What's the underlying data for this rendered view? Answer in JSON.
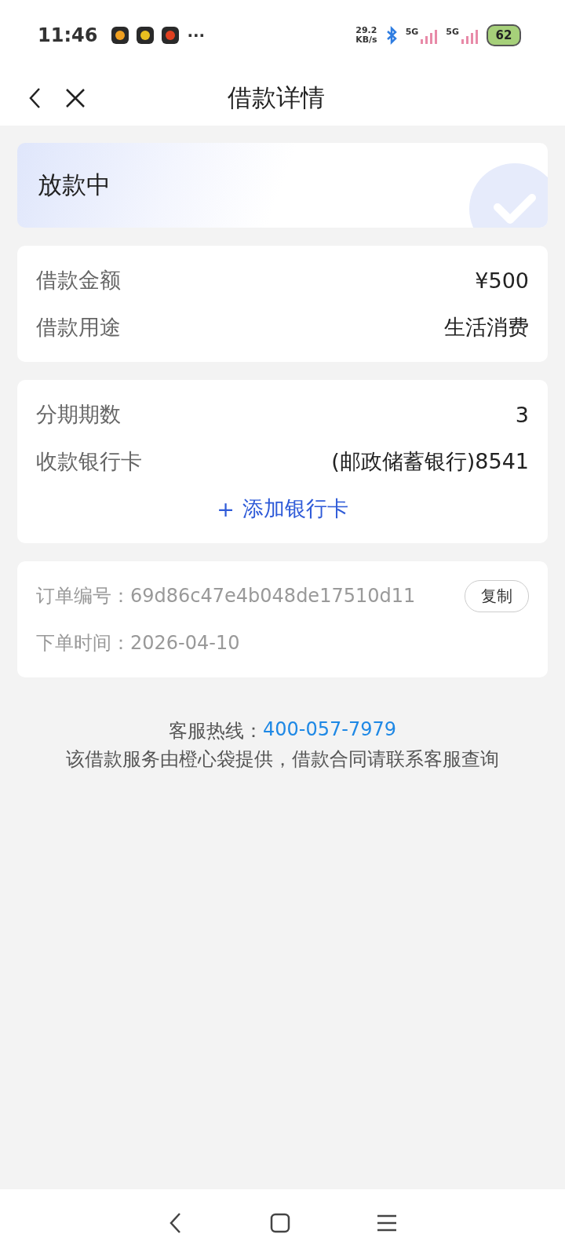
{
  "status_bar": {
    "time": "11:46",
    "notification_icons": [
      {
        "color": "#f0a020"
      },
      {
        "color": "#e8c020"
      },
      {
        "color": "#e04020"
      }
    ],
    "more": "···",
    "speed_value": "29.2",
    "speed_unit": "KB/s",
    "signals": [
      {
        "label": "5G"
      },
      {
        "label": "5G"
      }
    ],
    "battery": "62"
  },
  "header": {
    "title": "借款详情"
  },
  "status_card": {
    "title": "放款中"
  },
  "loan_info": [
    {
      "label": "借款金额",
      "value": "¥500"
    },
    {
      "label": "借款用途",
      "value": "生活消费"
    }
  ],
  "repay_info": [
    {
      "label": "分期期数",
      "value": "3"
    },
    {
      "label": "收款银行卡",
      "value": "(邮政储蓄银行)8541"
    }
  ],
  "add_card": {
    "icon": "+",
    "label": "添加银行卡"
  },
  "order": {
    "number_label": "订单编号：",
    "number": "69d86c47e4b048de17510d11",
    "copy_button": "复制",
    "time_label": "下单时间：",
    "time": "2026-04-10"
  },
  "footer": {
    "hotline_label": "客服热线：",
    "hotline": "400-057-7979",
    "note": "该借款服务由橙心袋提供，借款合同请联系客服查询"
  }
}
